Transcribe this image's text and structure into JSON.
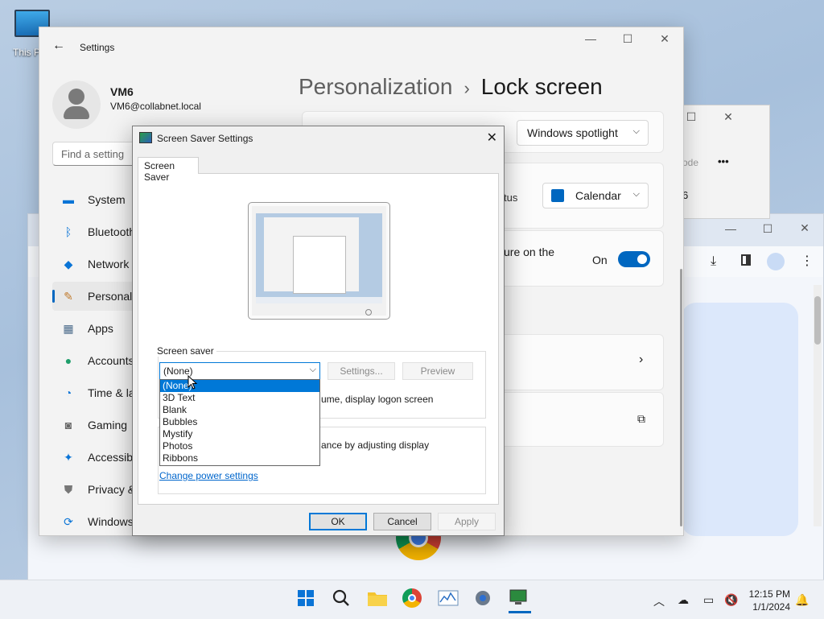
{
  "desktop": {
    "icon_label": "This P"
  },
  "settings": {
    "title": "Settings",
    "user": {
      "name": "VM6",
      "email": "VM6@collabnet.local"
    },
    "search_placeholder": "Find a setting",
    "nav": [
      {
        "label": "System",
        "icon": "monitor-icon"
      },
      {
        "label": "Bluetooth",
        "icon": "bluetooth-icon"
      },
      {
        "label": "Network",
        "icon": "wifi-icon"
      },
      {
        "label": "Personali",
        "icon": "brush-icon",
        "active": true
      },
      {
        "label": "Apps",
        "icon": "apps-icon"
      },
      {
        "label": "Accounts",
        "icon": "person-icon"
      },
      {
        "label": "Time & la",
        "icon": "clock-globe-icon"
      },
      {
        "label": "Gaming",
        "icon": "gamepad-icon"
      },
      {
        "label": "Accessibi",
        "icon": "accessibility-icon"
      },
      {
        "label": "Privacy &",
        "icon": "shield-icon"
      },
      {
        "label": "Windows",
        "icon": "update-icon"
      }
    ],
    "breadcrumb": {
      "parent": "Personalization",
      "separator": "›",
      "current": "Lock screen"
    },
    "lock_dropdown": "Windows spotlight",
    "status_label": "tus",
    "status_dropdown": "Calendar",
    "picture_text": "ure on the",
    "toggle_label": "On"
  },
  "mid_window": {
    "text": "ode",
    "more": "•••",
    "digit": "6"
  },
  "dialog": {
    "title": "Screen Saver Settings",
    "tab": "Screen Saver",
    "group_label": "Screen saver",
    "selected": "(None)",
    "options": [
      "(None)",
      "3D Text",
      "Blank",
      "Bubbles",
      "Mystify",
      "Photos",
      "Ribbons"
    ],
    "settings_button": "Settings...",
    "preview_button": "Preview",
    "resume_text": "ume, display logon screen",
    "power_text": "ance by adjusting display",
    "power_link": "Change power settings",
    "ok": "OK",
    "cancel": "Cancel",
    "apply": "Apply"
  },
  "taskbar": {
    "time": "12:15 PM",
    "date": "1/1/2024"
  },
  "colors": {
    "accent": "#0067c0",
    "dialog_accent": "#0078d7"
  }
}
